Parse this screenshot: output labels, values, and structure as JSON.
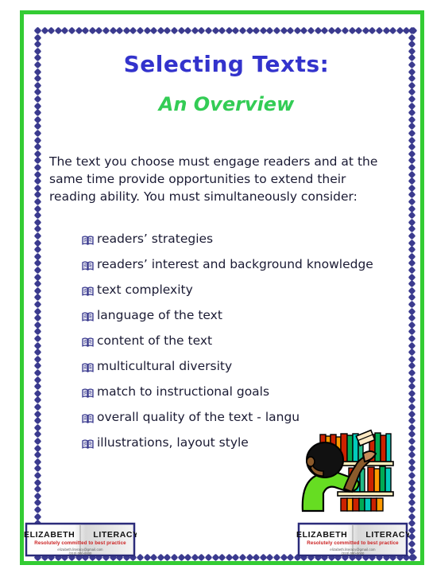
{
  "slide": {
    "title": "Selecting Texts:",
    "subtitle": "An Overview",
    "intro": "The text you choose must engage readers and at the same time provide opportunities to extend their reading ability.  You must simultaneously consider:",
    "bullets": [
      "readers’ strategies",
      "readers’ interest and background knowledge",
      "text complexity",
      "language of the text",
      "content of the text",
      "multicultural diversity",
      "match to instructional goals",
      "overall quality of the text - langu",
      "illustrations, layout style"
    ],
    "bullet_icon": "open-book-icon"
  },
  "colors": {
    "frame_green": "#33cc33",
    "dot_navy": "#3b3b8f",
    "title_blue": "#3333cc",
    "subtitle_green": "#33cc55",
    "body_navy": "#1a1a33",
    "logo_tagline_red": "#cc2222",
    "shirt_green": "#66dd22",
    "hair_black": "#111111",
    "skin_brown": "#8b5a2b"
  },
  "clipart": {
    "name": "child-reaching-for-books-on-bookshelf",
    "alt": "Illustration of a child in a green shirt reaching up for a book on a library bookshelf"
  },
  "logo": {
    "name_left": "ELIZABETH",
    "name_right": "LITERACY",
    "tagline": "Resolutely committed to best practice",
    "contact": "elizabeth.literacy@gmail.com",
    "phone": "(310) 000-0000"
  }
}
